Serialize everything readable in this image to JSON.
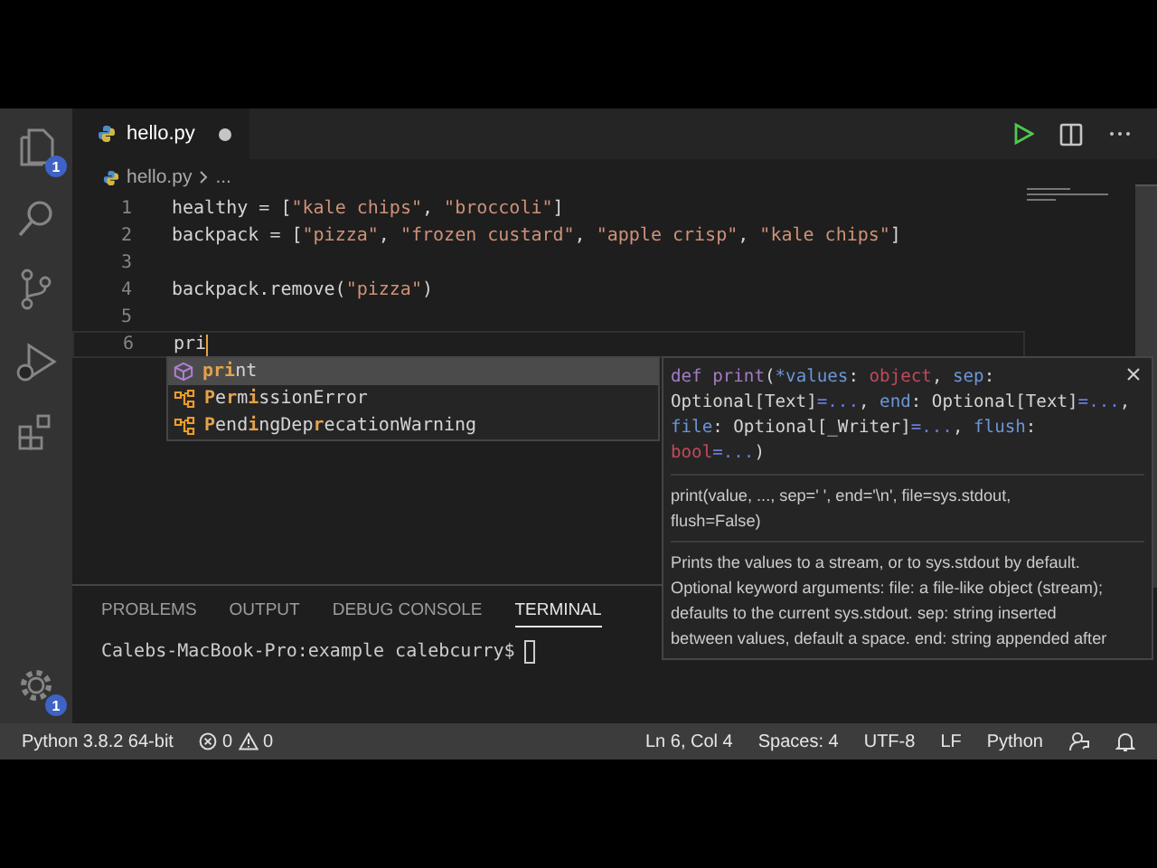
{
  "activity_bar": {
    "explorer_badge": "1",
    "settings_badge": "1"
  },
  "tabs": [
    {
      "label": "hello.py",
      "selected": true,
      "modified": true
    }
  ],
  "breadcrumb": {
    "file": "hello.py",
    "rest": "..."
  },
  "code": [
    {
      "number": "1",
      "tokens": [
        {
          "kind": "plain",
          "text": "healthy "
        },
        {
          "kind": "op",
          "text": "="
        },
        {
          "kind": "plain",
          "text": " ["
        },
        {
          "kind": "string",
          "text": "\"kale chips\""
        },
        {
          "kind": "plain",
          "text": ", "
        },
        {
          "kind": "string",
          "text": "\"broccoli\""
        },
        {
          "kind": "plain",
          "text": "]"
        }
      ]
    },
    {
      "number": "2",
      "tokens": [
        {
          "kind": "plain",
          "text": "backpack "
        },
        {
          "kind": "op",
          "text": "="
        },
        {
          "kind": "plain",
          "text": " ["
        },
        {
          "kind": "string",
          "text": "\"pizza\""
        },
        {
          "kind": "plain",
          "text": ", "
        },
        {
          "kind": "string",
          "text": "\"frozen custard\""
        },
        {
          "kind": "plain",
          "text": ", "
        },
        {
          "kind": "string",
          "text": "\"apple crisp\""
        },
        {
          "kind": "plain",
          "text": ", "
        },
        {
          "kind": "string",
          "text": "\"kale chips\""
        },
        {
          "kind": "plain",
          "text": "]"
        }
      ]
    },
    {
      "number": "3"
    },
    {
      "number": "4",
      "tokens": [
        {
          "kind": "plain",
          "text": "backpack.remove("
        },
        {
          "kind": "string",
          "text": "\"pizza\""
        },
        {
          "kind": "plain",
          "text": ")"
        }
      ]
    },
    {
      "number": "5"
    },
    {
      "number": "6",
      "tokens": [
        {
          "kind": "plain",
          "text": "pri"
        }
      ],
      "current": true
    }
  ],
  "suggestions": [
    {
      "kind": "function",
      "label": "**pri**nt",
      "selected": true
    },
    {
      "kind": "class",
      "label": "**P**e**r**m**i**ssionError",
      "selected": false
    },
    {
      "kind": "class",
      "label": "**P**end**i**ngDep**r**ecationWarning",
      "selected": false
    }
  ],
  "hover": {
    "signature": [
      [
        {
          "kind": "keyword",
          "text": "def "
        },
        {
          "kind": "keyword",
          "text": "print"
        },
        {
          "kind": "plain",
          "text": "("
        },
        {
          "kind": "param",
          "text": "*values"
        },
        {
          "kind": "plain",
          "text": ": "
        },
        {
          "kind": "type",
          "text": "object"
        },
        {
          "kind": "plain",
          "text": ", "
        },
        {
          "kind": "param",
          "text": "sep"
        },
        {
          "kind": "plain",
          "text": ":"
        }
      ],
      [
        {
          "kind": "plain",
          "text": "Optional[Text]"
        },
        {
          "kind": "default",
          "text": "=..."
        },
        {
          "kind": "plain",
          "text": ", "
        },
        {
          "kind": "param",
          "text": "end"
        },
        {
          "kind": "plain",
          "text": ": Optional[Text]"
        },
        {
          "kind": "default",
          "text": "=..."
        },
        {
          "kind": "plain",
          "text": ","
        }
      ],
      [
        {
          "kind": "param",
          "text": "file"
        },
        {
          "kind": "plain",
          "text": ": Optional[_Writer]"
        },
        {
          "kind": "default",
          "text": "=..."
        },
        {
          "kind": "plain",
          "text": ", "
        },
        {
          "kind": "param",
          "text": "flush"
        },
        {
          "kind": "plain",
          "text": ":"
        }
      ],
      [
        {
          "kind": "type",
          "text": "bool"
        },
        {
          "kind": "default",
          "text": "=..."
        },
        {
          "kind": "plain",
          "text": ")"
        }
      ]
    ],
    "usage": [
      "print(value, ..., sep=' ', end='\\n', file=sys.stdout,",
      "flush=False)"
    ],
    "doc": [
      "Prints the values to a stream, or to sys.stdout by default.",
      "Optional keyword arguments: file: a file-like object (stream);",
      "defaults to the current sys.stdout. sep: string inserted",
      "between values, default a space. end: string appended after"
    ]
  },
  "panel": {
    "tabs": [
      {
        "label": "PROBLEMS",
        "selected": false
      },
      {
        "label": "OUTPUT",
        "selected": false
      },
      {
        "label": "DEBUG CONSOLE",
        "selected": false
      },
      {
        "label": "TERMINAL",
        "selected": true
      }
    ],
    "terminal_prompt": "Calebs-MacBook-Pro:example calebcurry$"
  },
  "status_bar": {
    "interpreter": "Python 3.8.2 64-bit",
    "errors": "0",
    "warnings": "0",
    "position": "Ln 6, Col 4",
    "indent": "Spaces: 4",
    "encoding": "UTF-8",
    "eol": "LF",
    "language": "Python"
  }
}
